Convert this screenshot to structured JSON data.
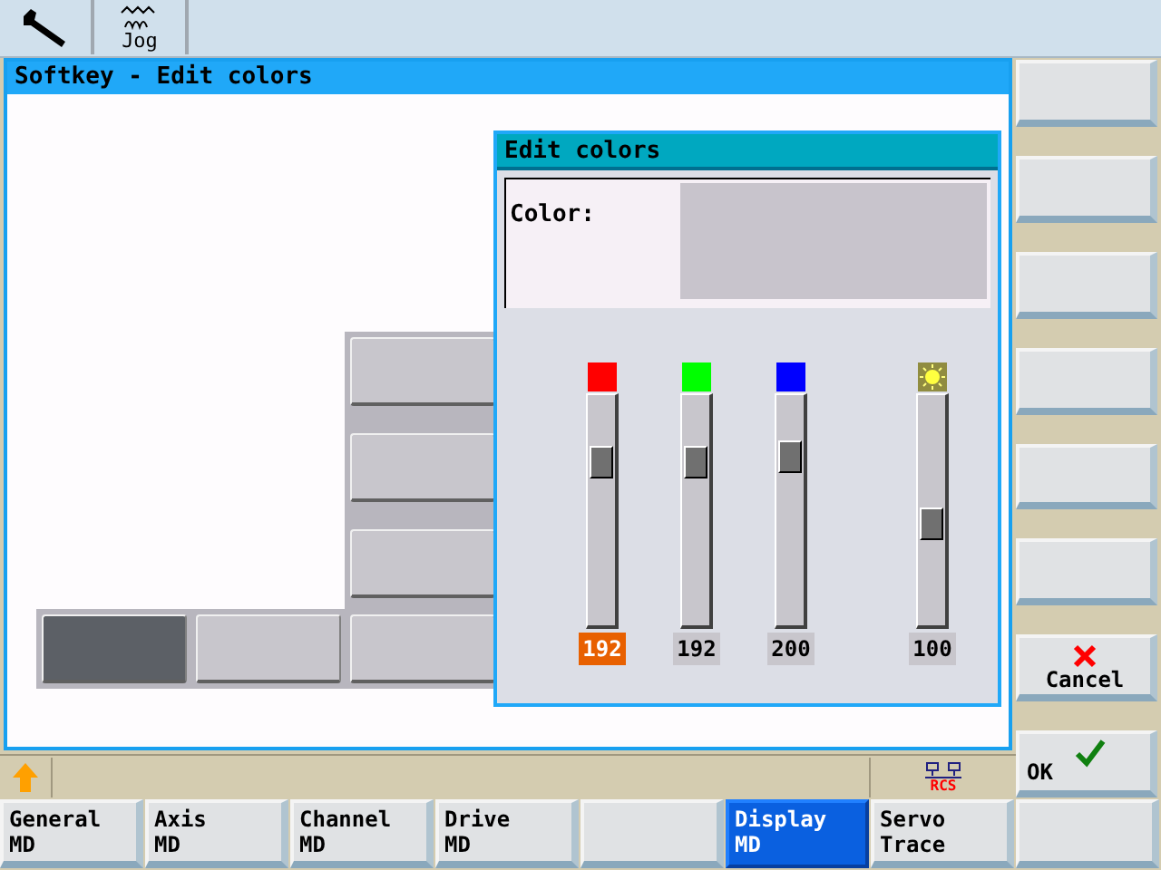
{
  "top_bar": {
    "items": [
      {
        "kind": "wrench"
      },
      {
        "kind": "jog",
        "label": "Jog"
      }
    ]
  },
  "window": {
    "title": "Softkey - Edit colors"
  },
  "preview_keys": [
    {
      "selected": false
    },
    {
      "selected": false
    },
    {
      "selected": false
    },
    {
      "selected": true
    },
    {
      "selected": false
    },
    {
      "selected": false
    }
  ],
  "dialog": {
    "title": "Edit colors",
    "color_label": "Color:",
    "channels": [
      {
        "kind": "color",
        "color": "#ff0000",
        "level": 0.75,
        "reading": "192",
        "selected": true
      },
      {
        "kind": "color",
        "color": "#00ff00",
        "level": 0.75,
        "reading": "192",
        "selected": false
      },
      {
        "kind": "color",
        "color": "#0000ff",
        "level": 0.78,
        "reading": "200",
        "selected": false
      },
      {
        "kind": "brightness",
        "level": 0.45,
        "reading": "100",
        "selected": false
      }
    ]
  },
  "status_bar": {
    "badge": "RCS"
  },
  "right_softkeys": [
    {
      "kind": "blank"
    },
    {
      "kind": "blank"
    },
    {
      "kind": "blank"
    },
    {
      "kind": "blank"
    },
    {
      "kind": "blank"
    },
    {
      "kind": "blank"
    },
    {
      "kind": "cancel",
      "label": "Cancel"
    },
    {
      "kind": "ok",
      "label": "OK"
    }
  ],
  "bottom_softkeys": [
    {
      "lines": [
        "General",
        "MD"
      ],
      "selected": false
    },
    {
      "lines": [
        "Axis",
        "MD"
      ],
      "selected": false
    },
    {
      "lines": [
        "Channel",
        "MD"
      ],
      "selected": false
    },
    {
      "lines": [
        "Drive",
        "MD"
      ],
      "selected": false
    },
    {
      "selected": false
    },
    {
      "lines": [
        "Display",
        "MD"
      ],
      "selected": true
    },
    {
      "lines": [
        "Servo",
        "Trace"
      ],
      "selected": false
    },
    {
      "selected": false
    }
  ]
}
